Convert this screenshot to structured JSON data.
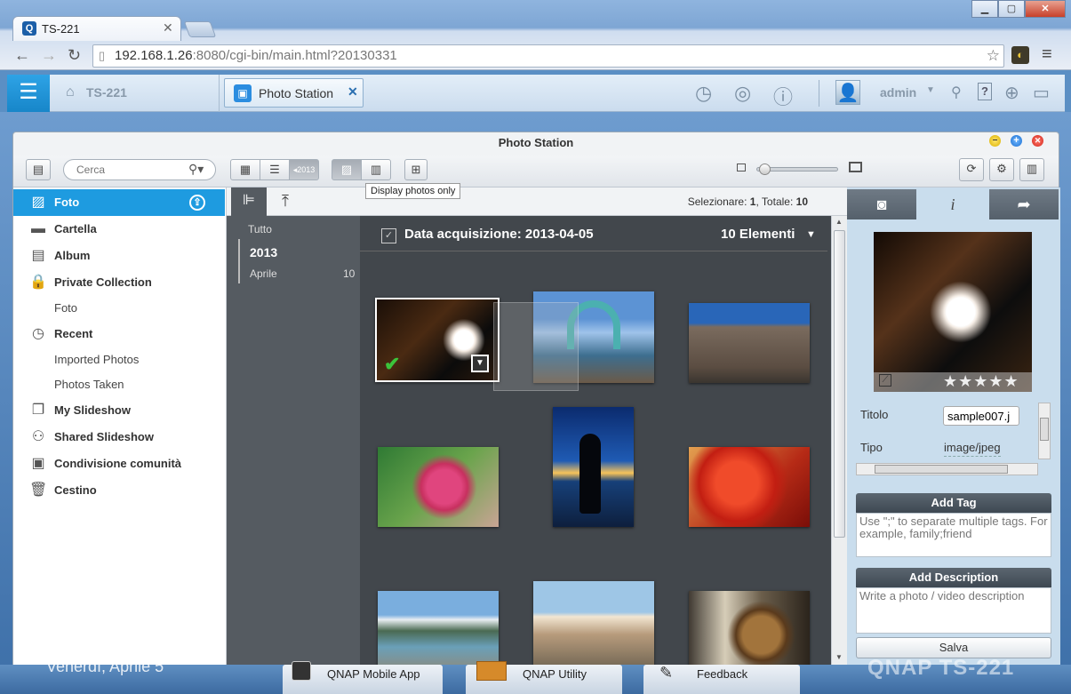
{
  "browser": {
    "tab_title": "TS-221",
    "url_host": "192.168.1.26",
    "url_rest": ":8080/cgi-bin/main.html?20130331"
  },
  "qnap_header": {
    "home_label": "TS-221",
    "app_tab_label": "Photo Station",
    "user_label": "admin"
  },
  "window": {
    "title": "Photo Station",
    "search_placeholder": "Cerca",
    "tooltip": "Display photos only"
  },
  "sidebar": {
    "items": [
      {
        "label": "Foto",
        "icon": "photo-icon"
      },
      {
        "label": "Cartella",
        "icon": "folder-icon"
      },
      {
        "label": "Album",
        "icon": "album-icon"
      },
      {
        "label": "Private Collection",
        "icon": "lock-icon"
      },
      {
        "label": "Foto",
        "icon": ""
      },
      {
        "label": "Recent",
        "icon": "clock-icon"
      },
      {
        "label": "Imported Photos",
        "icon": ""
      },
      {
        "label": "Photos Taken",
        "icon": ""
      },
      {
        "label": "My Slideshow",
        "icon": "slideshow-icon"
      },
      {
        "label": "Shared Slideshow",
        "icon": "shared-slideshow-icon"
      },
      {
        "label": "Condivisione comunità",
        "icon": "community-share-icon"
      },
      {
        "label": "Cestino",
        "icon": "trash-icon"
      }
    ]
  },
  "mainbar": {
    "select_label": "Selezionare:",
    "select_count": "1",
    "total_label": ", Totale:",
    "total_count": "10"
  },
  "timeline": {
    "all_label": "Tutto",
    "year": "2013",
    "month": "Aprile",
    "month_count": "10"
  },
  "group": {
    "title": "Data acquisizione: 2013-04-05",
    "count": "10 Elementi"
  },
  "details": {
    "title_label": "Titolo",
    "title_value": "sample007.j",
    "type_label": "Tipo",
    "type_value": "image/jpeg",
    "add_tag_header": "Add Tag",
    "add_tag_placeholder": "Use \";\" to separate multiple tags. For example, family;friend",
    "add_desc_header": "Add Description",
    "add_desc_placeholder": "Write a photo / video description",
    "save_label": "Salva"
  },
  "taskbar": {
    "date": "Venerdì, Aprile 5",
    "items": [
      "QNAP Mobile App",
      "QNAP Utility",
      "Feedback"
    ],
    "brand": "QNAP TS-221"
  }
}
